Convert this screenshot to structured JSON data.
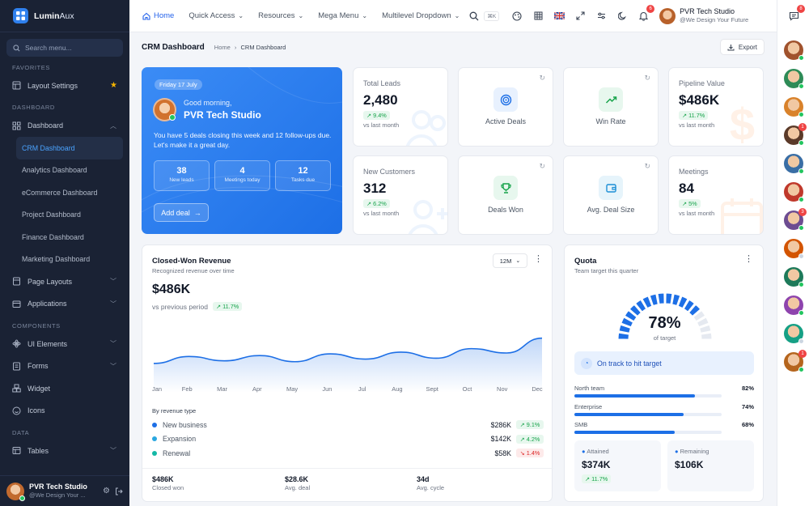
{
  "brand": {
    "name_bold": "Lumin",
    "name_light": "Aux"
  },
  "sidebar": {
    "search_placeholder": "Search menu...",
    "sections": {
      "favorites": "FAVORITES",
      "dashboard": "DASHBOARD",
      "components": "COMPONENTS",
      "data": "DATA"
    },
    "layout_settings": "Layout Settings",
    "dashboard": "Dashboard",
    "sub": [
      "CRM Dashboard",
      "Analytics Dashboard",
      "eCommerce Dashboard",
      "Project Dashboard",
      "Finance Dashboard",
      "Marketing Dashboard"
    ],
    "page_layouts": "Page Layouts",
    "applications": "Applications",
    "ui_elements": "UI Elements",
    "forms": "Forms",
    "widget": "Widget",
    "icons": "Icons",
    "tables": "Tables",
    "user": {
      "name": "PVR Tech Studio",
      "sub": "@We Design Your ..."
    }
  },
  "topbar": {
    "nav": [
      "Home",
      "Quick Access",
      "Resources",
      "Mega Menu",
      "Multilevel Dropdown"
    ],
    "kbd": "⌘K",
    "notif_count": "6",
    "user_name": "PVR Tech Studio",
    "user_sub": "@We Design Your Future",
    "chat_count": "8"
  },
  "page": {
    "title": "CRM Dashboard",
    "breadcrumb_home": "Home",
    "breadcrumb_current": "CRM Dashboard",
    "export": "Export"
  },
  "hero": {
    "date": "Friday 17 July",
    "greeting": "Good morning,",
    "name": "PVR Tech Studio",
    "message": "You have 5 deals closing this week and 12 follow-ups due. Let's make it a great day.",
    "stats": [
      {
        "value": "38",
        "label": "New leads"
      },
      {
        "value": "4",
        "label": "Meetings today"
      },
      {
        "value": "12",
        "label": "Tasks due"
      }
    ],
    "cta": "Add deal"
  },
  "stats": {
    "total_leads": {
      "label": "Total Leads",
      "value": "2,480",
      "change": "9.4%",
      "sub": "vs last month"
    },
    "pipeline": {
      "label": "Pipeline Value",
      "value": "$486K",
      "change": "11.7%",
      "sub": "vs last month"
    },
    "new_customers": {
      "label": "New Customers",
      "value": "312",
      "change": "6.2%",
      "sub": "vs last month"
    },
    "meetings": {
      "label": "Meetings",
      "value": "84",
      "change": "5%",
      "sub": "vs last month"
    },
    "active_deals": "Active Deals",
    "win_rate": "Win Rate",
    "deals_won": "Deals Won",
    "avg_deal": "Avg. Deal Size"
  },
  "revenue": {
    "title": "Closed-Won Revenue",
    "subtitle": "Recognized revenue over time",
    "range": "12M",
    "value": "$486K",
    "compare": "vs previous period",
    "change": "11.7%",
    "by_type": "By revenue type",
    "types": [
      {
        "name": "New business",
        "value": "$286K",
        "change": "9.1%",
        "dir": "up",
        "color": "#1d6fe6"
      },
      {
        "name": "Expansion",
        "value": "$142K",
        "change": "4.2%",
        "dir": "up",
        "color": "#2aa7e0"
      },
      {
        "name": "Renewal",
        "value": "$58K",
        "change": "1.4%",
        "dir": "down",
        "color": "#14b8a6"
      }
    ],
    "footer": [
      {
        "value": "$486K",
        "label": "Closed won"
      },
      {
        "value": "$28.6K",
        "label": "Avg. deal"
      },
      {
        "value": "34d",
        "label": "Avg. cycle"
      }
    ]
  },
  "chart_data": {
    "type": "area",
    "categories": [
      "Jan",
      "Feb",
      "Mar",
      "Apr",
      "May",
      "Jun",
      "Jul",
      "Aug",
      "Sept",
      "Oct",
      "Nov",
      "Dec"
    ],
    "series": [
      {
        "values": [
          28,
          36,
          31,
          37,
          30,
          39,
          33,
          41,
          34,
          45,
          40,
          57
        ]
      }
    ],
    "ylim": [
      0,
      80
    ],
    "grid": false
  },
  "quota": {
    "title": "Quota",
    "subtitle": "Team target this quarter",
    "percent": "78%",
    "percent_value": 0.78,
    "of_target": "of target",
    "status": "On track to hit target",
    "teams": [
      {
        "name": "North team",
        "value": "82%",
        "fraction": 0.82
      },
      {
        "name": "Enterprise",
        "value": "74%",
        "fraction": 0.74
      },
      {
        "name": "SMB",
        "value": "68%",
        "fraction": 0.68
      }
    ],
    "attained_label": "Attained",
    "attained": "$374K",
    "attained_change": "11.7%",
    "remaining_label": "Remaining",
    "remaining": "$106K"
  },
  "contacts": {
    "badges": [
      "1",
      "3",
      "1"
    ],
    "colors": [
      "#a0522d",
      "#2e8b57",
      "#d9822b",
      "#5b3a29",
      "#3a6ea5",
      "#c0392b",
      "#6d4c91",
      "#d35400",
      "#1e7a5a",
      "#8e44ad",
      "#16a085",
      "#b5651d"
    ]
  }
}
